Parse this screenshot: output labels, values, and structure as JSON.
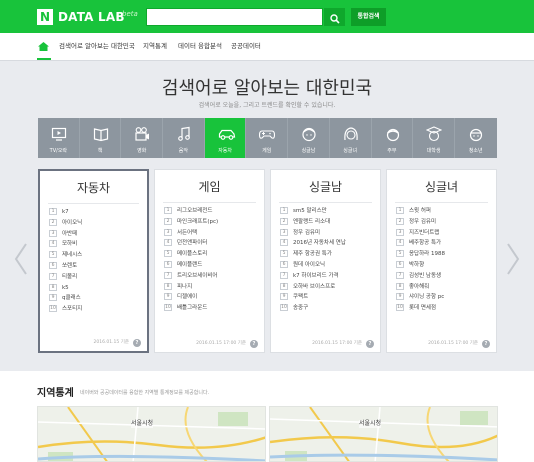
{
  "header": {
    "logo_mark": "N",
    "logo_text": "DATA LAB",
    "logo_beta": "beta",
    "search_value": "",
    "compare_label": "통합검색"
  },
  "nav": {
    "items": [
      "검색어로 알아보는 대한민국",
      "지역통계",
      "데이터 융합분석",
      "공공데이터"
    ]
  },
  "hero": {
    "title": "검색어로 알아보는 대한민국",
    "subtitle": "검색어로 오늘을, 그리고 트렌드를 확인할 수 있습니다."
  },
  "categories": [
    {
      "label": "TV/오락",
      "icon": "tv-icon"
    },
    {
      "label": "책",
      "icon": "book-icon"
    },
    {
      "label": "영화",
      "icon": "film-icon"
    },
    {
      "label": "음악",
      "icon": "music-icon"
    },
    {
      "label": "자동차",
      "icon": "car-icon",
      "active": true
    },
    {
      "label": "게임",
      "icon": "gamepad-icon"
    },
    {
      "label": "싱글남",
      "icon": "man-icon"
    },
    {
      "label": "싱글녀",
      "icon": "woman-icon"
    },
    {
      "label": "주부",
      "icon": "housewife-icon"
    },
    {
      "label": "대학생",
      "icon": "student-icon"
    },
    {
      "label": "청소년",
      "icon": "teen-icon"
    }
  ],
  "cards": [
    {
      "title": "자동차",
      "items": [
        "k7",
        "아이오닉",
        "아반떼",
        "모하비",
        "제네시스",
        "쏘렌토",
        "티볼리",
        "k5",
        "q클래스",
        "스포티지"
      ],
      "date": "2016.01.15 기준",
      "help": "?"
    },
    {
      "title": "게임",
      "items": [
        "리그오브레전드",
        "마인크래프트(pc)",
        "서든어택",
        "던전앤파이터",
        "메이플스토리",
        "메이플랜드",
        "트리오브세이비어",
        "피나지",
        "디젤에이",
        "배틀그라운드"
      ],
      "date": "2016.01.15 17:00 기준",
      "help": "?"
    },
    {
      "title": "싱글남",
      "items": [
        "sm5 말리스만",
        "엔팔랭드 리소대",
        "정우 김유미",
        "2016년 자동차세 연납",
        "제주 항공권 특가",
        "원데 아이오닉",
        "k7 하이브리드 가격",
        "오하바 브이스프로",
        "쿠팩트",
        "송중구"
      ],
      "date": "2016.01.15 17:00 기준",
      "help": "?"
    },
    {
      "title": "싱글녀",
      "items": [
        "스윗 허퍼",
        "정우 김유미",
        "지즈빈더트랩",
        "베주항공 특가",
        "응답하라 1988",
        "박하향",
        "김성빈 남동생",
        "좋아해줘",
        "샤이닝 공항 pc",
        "롯데 면세점"
      ],
      "date": "2016.01.15 17:00 기준",
      "help": "?"
    }
  ],
  "region": {
    "title": "지역통계",
    "description": "네이버와 공공데이터를 융합한 지역별 통계정보를 제공합니다.",
    "map_labels": [
      "서울시청",
      "서울시청"
    ]
  },
  "colors": {
    "brand_green": "#18c33b",
    "category_bar": "#8d969f"
  }
}
